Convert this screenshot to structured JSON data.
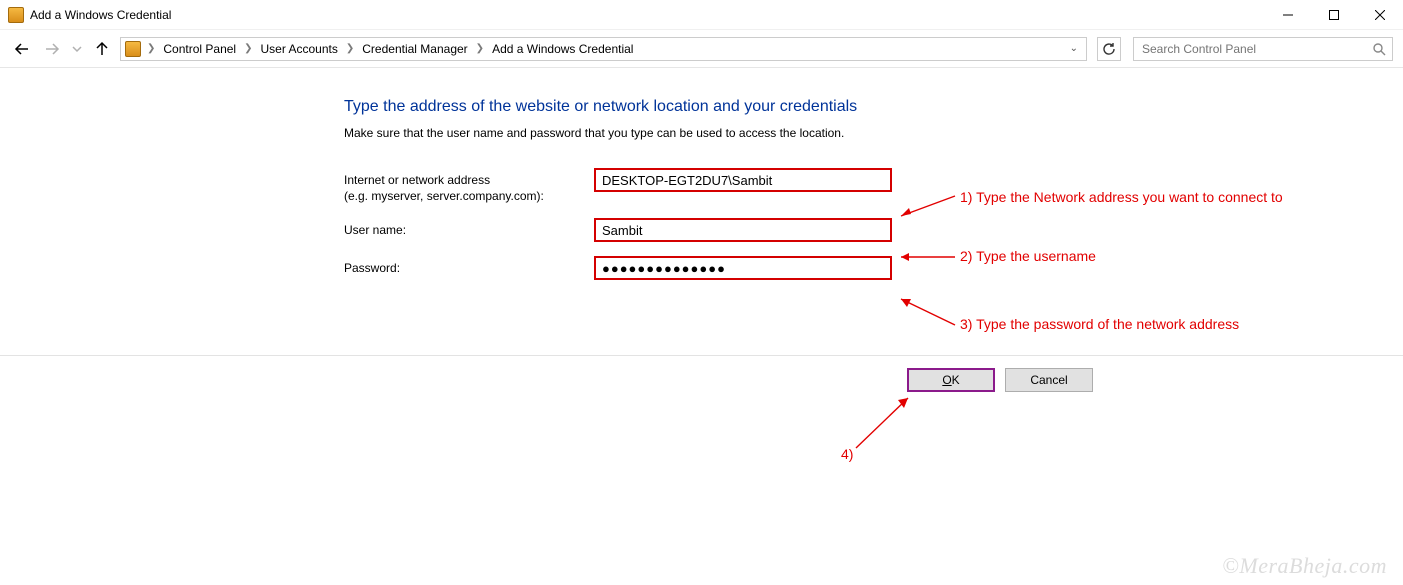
{
  "window": {
    "title": "Add a Windows Credential"
  },
  "breadcrumb": {
    "items": [
      "Control Panel",
      "User Accounts",
      "Credential Manager",
      "Add a Windows Credential"
    ]
  },
  "search": {
    "placeholder": "Search Control Panel"
  },
  "page": {
    "heading": "Type the address of the website or network location and your credentials",
    "subtext": "Make sure that the user name and password that you type can be used to access the location."
  },
  "form": {
    "address_label_line1": "Internet or network address",
    "address_label_line2": "(e.g. myserver, server.company.com):",
    "address_value": "DESKTOP-EGT2DU7\\Sambit",
    "username_label": "User name:",
    "username_value": "Sambit",
    "password_label": "Password:",
    "password_value": "●●●●●●●●●●●●●●"
  },
  "buttons": {
    "ok": "OK",
    "cancel": "Cancel"
  },
  "annotations": {
    "a1": "1) Type the Network address you want to connect to",
    "a2": "2) Type the username",
    "a3": "3) Type the password of the network address",
    "a4": "4)"
  },
  "watermark": "©MeraBheja.com"
}
